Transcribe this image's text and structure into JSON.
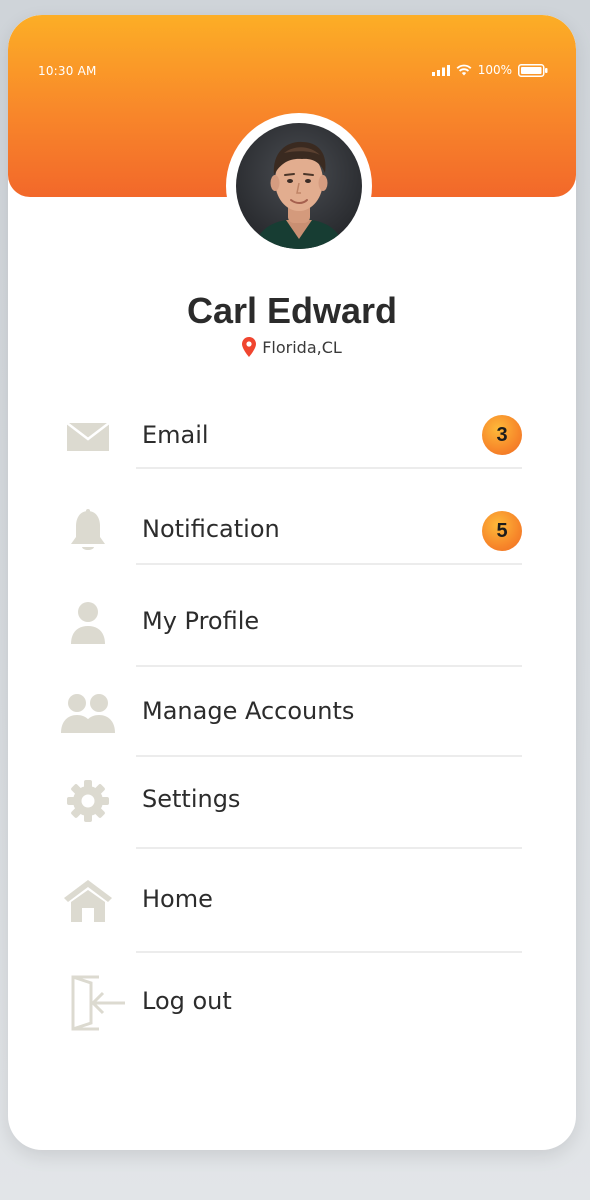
{
  "status_bar": {
    "time": "10:30 AM",
    "battery": "100%"
  },
  "profile": {
    "name": "Carl Edward",
    "location": "Florida,CL"
  },
  "menu": [
    {
      "label": "Email",
      "icon": "mail-icon",
      "badge": "3"
    },
    {
      "label": "Notification",
      "icon": "bell-icon",
      "badge": "5"
    },
    {
      "label": "My Profile",
      "icon": "user-icon"
    },
    {
      "label": "Manage Accounts",
      "icon": "users-icon"
    },
    {
      "label": "Settings",
      "icon": "gear-icon"
    },
    {
      "label": "Home",
      "icon": "home-icon"
    },
    {
      "label": "Log out",
      "icon": "logout-icon"
    }
  ],
  "colors": {
    "accent_top": "#fcae26",
    "accent_bottom": "#f2682a",
    "icon": "#dcdad0",
    "pin": "#f0452f"
  }
}
